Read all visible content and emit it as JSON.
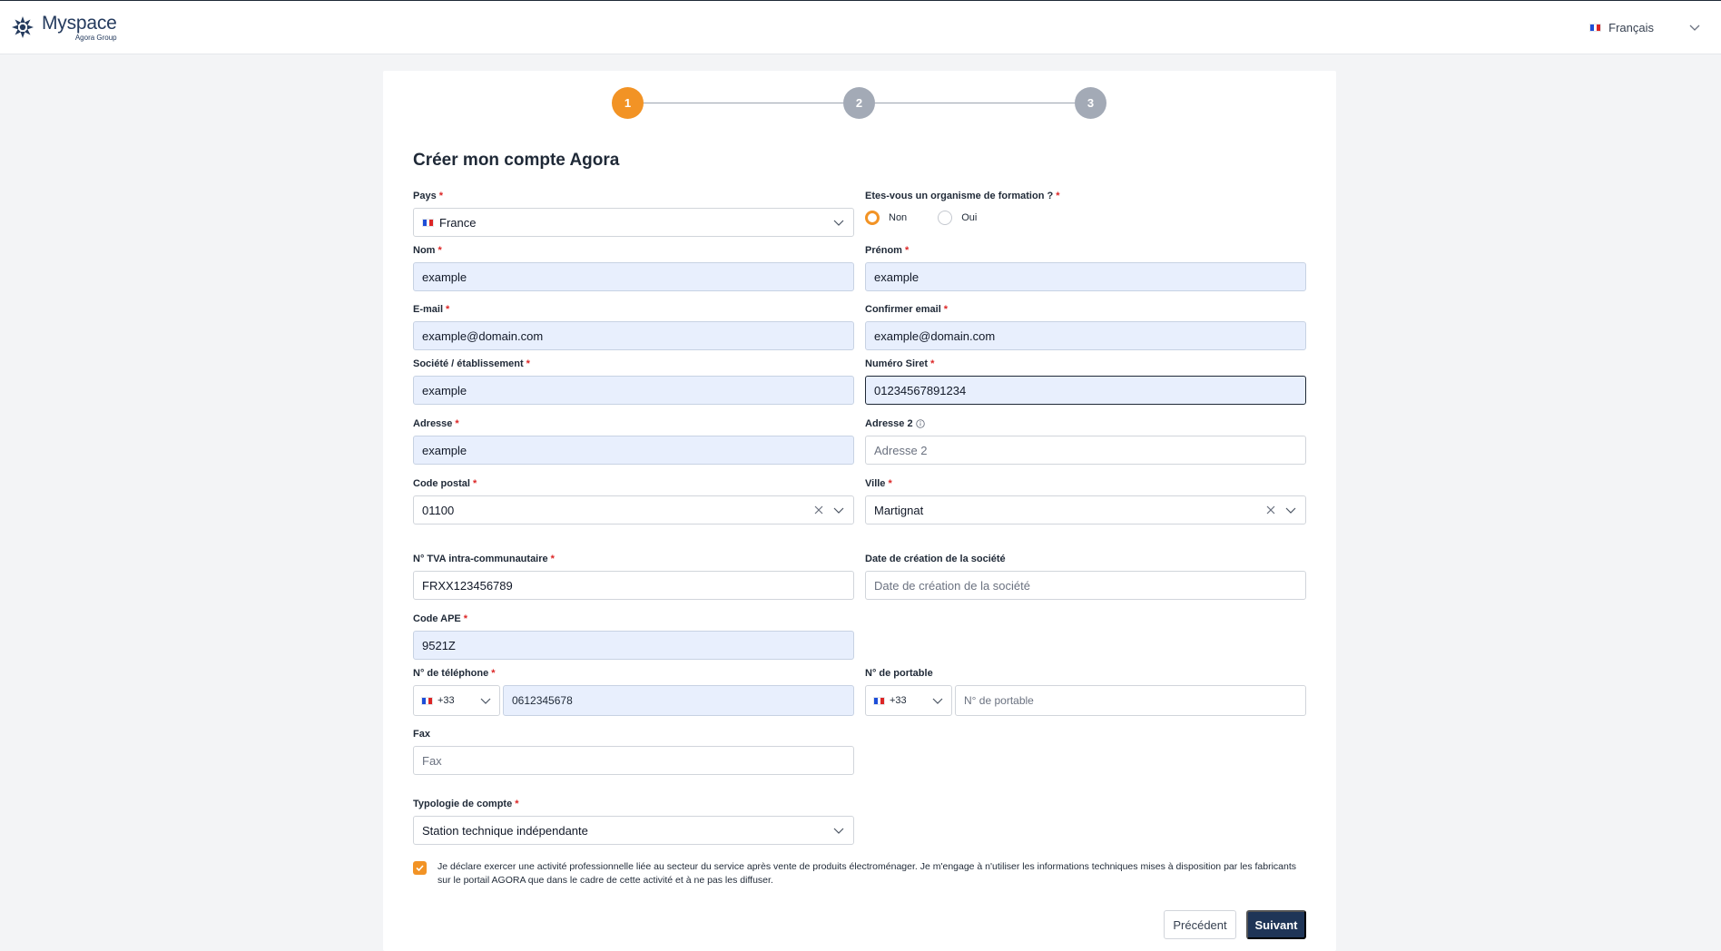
{
  "header": {
    "brand_name": "Myspace",
    "brand_sub": "Agora Group",
    "language": "Français"
  },
  "stepper": {
    "steps": [
      "1",
      "2",
      "3"
    ],
    "active": 1
  },
  "form": {
    "title": "Créer mon compte Agora",
    "pays": {
      "label": "Pays",
      "value": "France"
    },
    "organisme": {
      "label": "Etes-vous un organisme de formation ?",
      "options": [
        "Non",
        "Oui"
      ],
      "selected": "Non"
    },
    "nom": {
      "label": "Nom",
      "value": "example"
    },
    "prenom": {
      "label": "Prénom",
      "value": "example"
    },
    "email": {
      "label": "E-mail",
      "value": "example@domain.com"
    },
    "confirm_email": {
      "label": "Confirmer email",
      "value": "example@domain.com"
    },
    "societe": {
      "label": "Société / établissement",
      "value": "example"
    },
    "siret": {
      "label": "Numéro Siret",
      "value": "01234567891234"
    },
    "adresse": {
      "label": "Adresse",
      "value": "example"
    },
    "adresse2": {
      "label": "Adresse 2",
      "placeholder": "Adresse 2"
    },
    "code_postal": {
      "label": "Code postal",
      "value": "01100"
    },
    "ville": {
      "label": "Ville",
      "value": "Martignat"
    },
    "tva": {
      "label": "N° TVA intra-communautaire",
      "value": "FRXX123456789"
    },
    "date_creation": {
      "label": "Date de création de la société",
      "placeholder": "Date de création de la société"
    },
    "code_ape": {
      "label": "Code APE",
      "value": "9521Z"
    },
    "telephone": {
      "label": "N° de téléphone",
      "prefix": "+33",
      "value": "0612345678"
    },
    "portable": {
      "label": "N° de portable",
      "prefix": "+33",
      "placeholder": "N° de portable"
    },
    "fax": {
      "label": "Fax",
      "placeholder": "Fax"
    },
    "typologie": {
      "label": "Typologie de compte",
      "value": "Station technique indépendante"
    },
    "consent_text": "Je déclare exercer une activité professionnelle liée au secteur du service après vente de produits électroménager. Je m'engage à n'utiliser les informations techniques mises à disposition par les fabricants sur le portail AGORA que dans le cadre de cette activité et à ne pas les diffuser.",
    "required_mark": "*"
  },
  "buttons": {
    "prev": "Précédent",
    "next": "Suivant"
  },
  "colors": {
    "accent": "#f29325",
    "primary": "#1f3557",
    "filled_bg": "#e8effd"
  }
}
